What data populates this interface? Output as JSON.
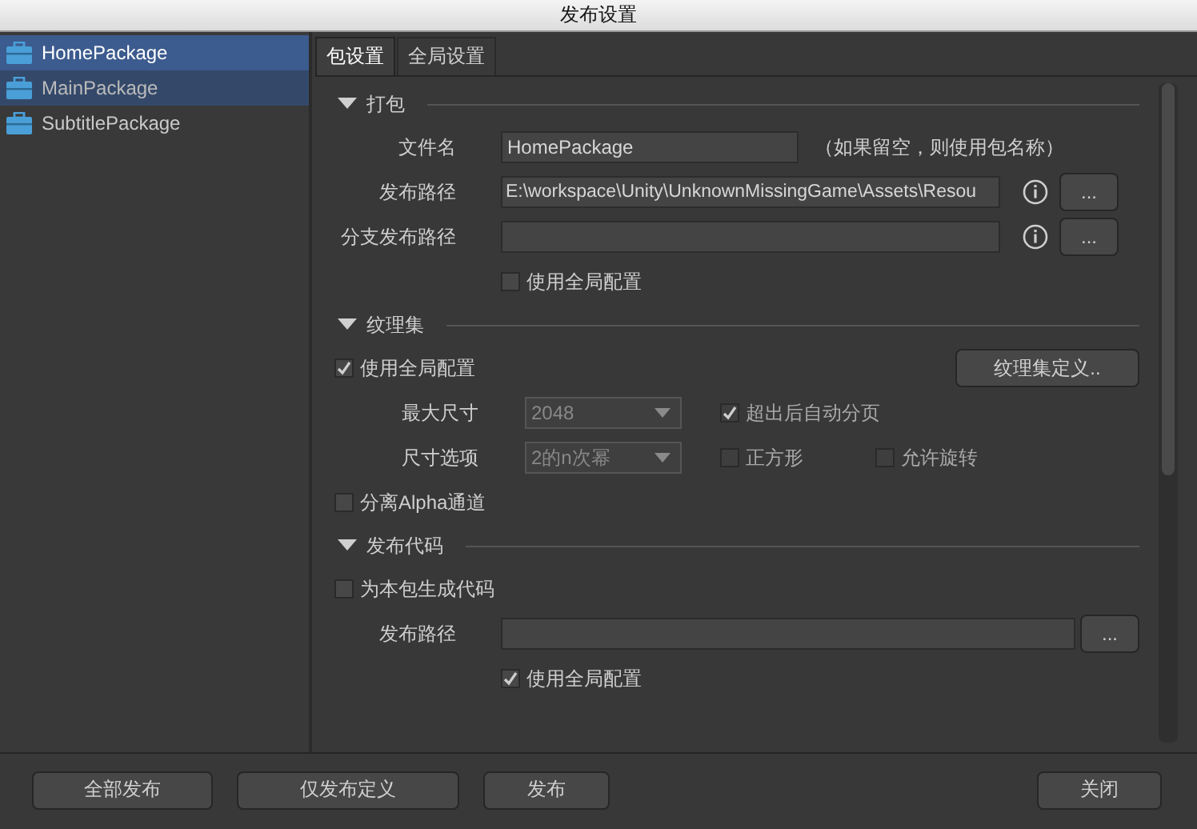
{
  "window": {
    "title": "发布设置"
  },
  "sidebar": {
    "items": [
      {
        "label": "HomePackage",
        "selected": true,
        "hovered": false
      },
      {
        "label": "MainPackage",
        "selected": false,
        "hovered": true
      },
      {
        "label": "SubtitlePackage",
        "selected": false,
        "hovered": false
      }
    ]
  },
  "tabs": [
    {
      "label": "包设置",
      "selected": true
    },
    {
      "label": "全局设置",
      "selected": false
    }
  ],
  "packing": {
    "title": "打包",
    "expanded": true,
    "file_name": {
      "label": "文件名",
      "value": "HomePackage",
      "hint": "（如果留空，则使用包名称）"
    },
    "publish_path": {
      "label": "发布路径",
      "value": "E:\\workspace\\Unity\\UnknownMissingGame\\Assets\\Resou",
      "browse": "..."
    },
    "branch_path": {
      "label": "分支发布路径",
      "browse": "..."
    },
    "use_global": {
      "label": "使用全局配置",
      "checked": false
    }
  },
  "atlas": {
    "title": "纹理集",
    "expanded": true,
    "use_global": {
      "label": "使用全局配置",
      "checked": true
    },
    "define_button": "纹理集定义..",
    "max_size": {
      "label": "最大尺寸",
      "value": "2048",
      "disabled": true
    },
    "auto_page": {
      "label": "超出后自动分页",
      "checked": true,
      "disabled": true
    },
    "size_option": {
      "label": "尺寸选项",
      "value": "2的n次幂",
      "disabled": true
    },
    "square": {
      "label": "正方形",
      "checked": false,
      "disabled": true
    },
    "rotate": {
      "label": "允许旋转",
      "checked": false,
      "disabled": true
    },
    "separate_alpha": {
      "label": "分离Alpha通道",
      "checked": false
    }
  },
  "code": {
    "title": "发布代码",
    "expanded": true,
    "generate": {
      "label": "为本包生成代码",
      "checked": false
    },
    "publish_path": {
      "label": "发布路径",
      "browse": "..."
    },
    "use_global": {
      "label": "使用全局配置",
      "checked": true
    }
  },
  "buttons": [
    "全部发布",
    "仅发布定义",
    "发布",
    "关闭"
  ]
}
